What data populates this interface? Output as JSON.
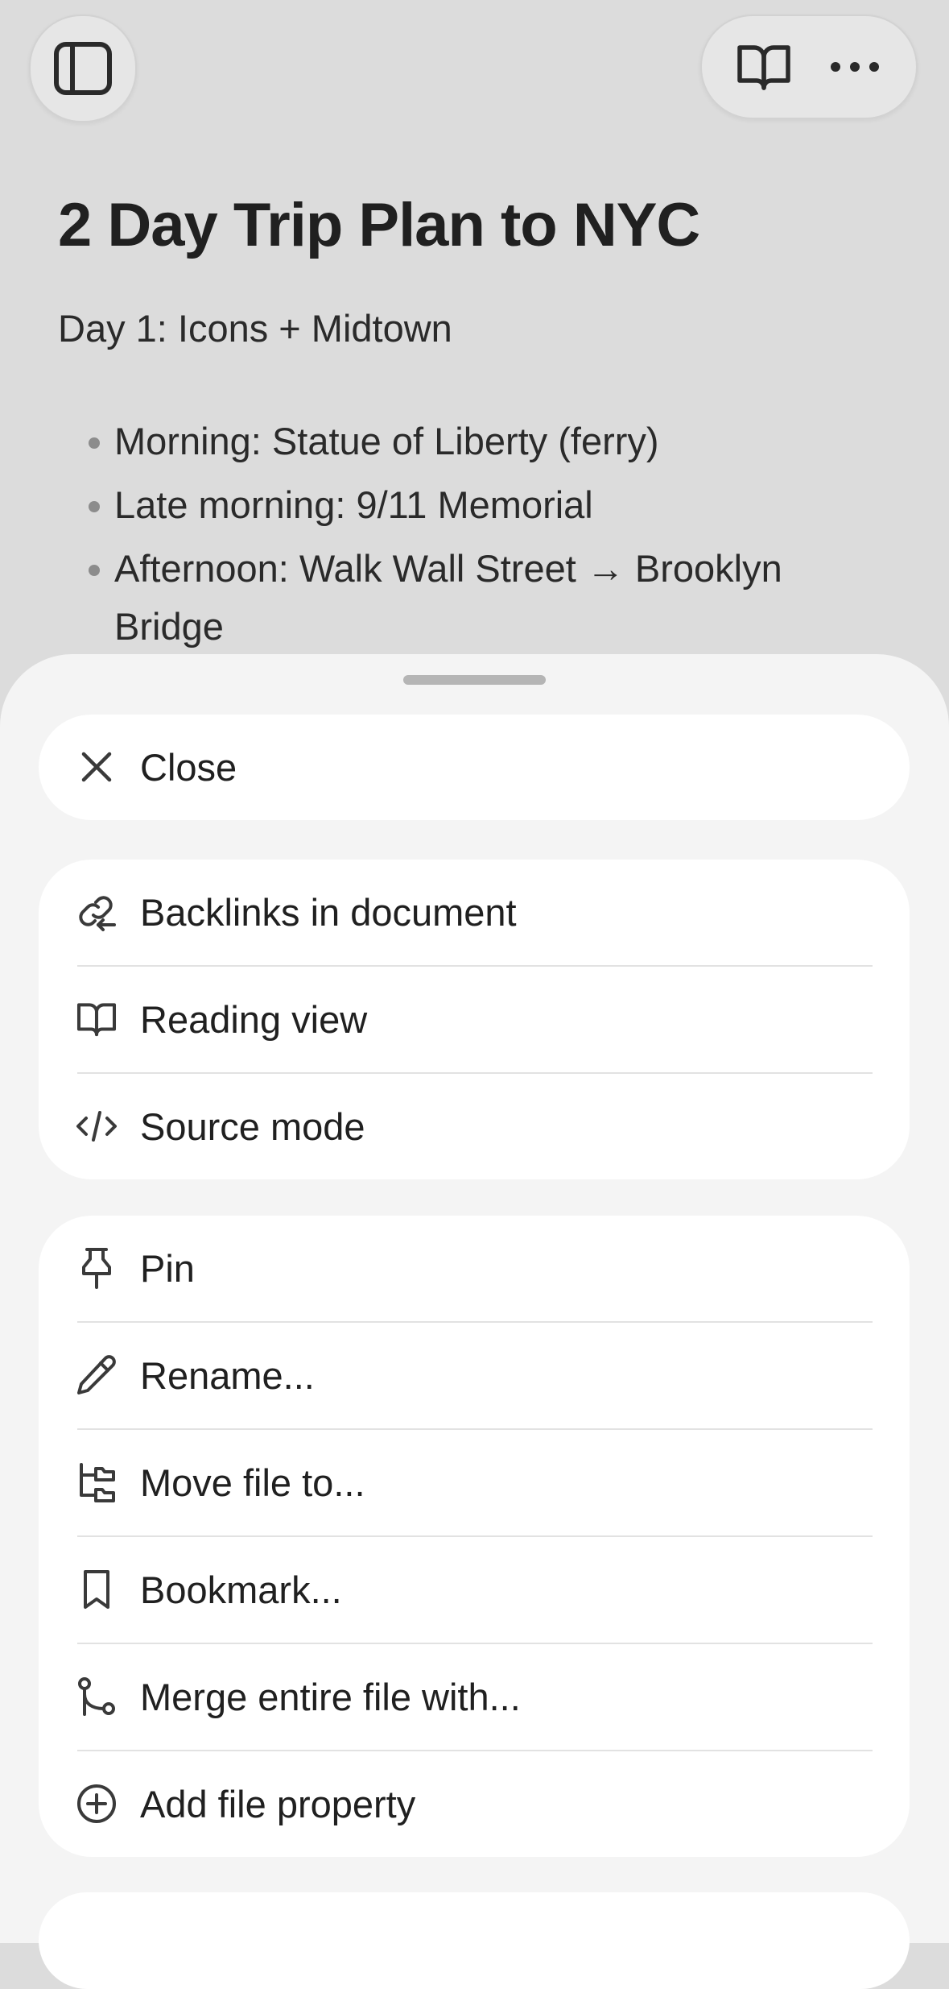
{
  "toolbar": {
    "left_icon": "sidebar-toggle-icon",
    "right_icons": [
      "book-open-icon",
      "more-horizontal-icon"
    ]
  },
  "document": {
    "title": "2 Day Trip Plan to NYC",
    "paragraph": "Day 1: Icons + Midtown",
    "bullets": [
      "Morning: Statue of Liberty (ferry)",
      "Late morning: 9/11 Memorial",
      "Afternoon: Walk Wall Street → Brooklyn Bridge"
    ]
  },
  "sheet": {
    "close": {
      "label": "Close",
      "icon": "close-icon"
    },
    "view_group": [
      {
        "label": "Backlinks in document",
        "icon": "backlink-icon"
      },
      {
        "label": "Reading view",
        "icon": "book-open-icon"
      },
      {
        "label": "Source mode",
        "icon": "code-icon"
      }
    ],
    "file_group": [
      {
        "label": "Pin",
        "icon": "pin-icon"
      },
      {
        "label": "Rename...",
        "icon": "pencil-icon"
      },
      {
        "label": "Move file to...",
        "icon": "folder-tree-icon"
      },
      {
        "label": "Bookmark...",
        "icon": "bookmark-icon"
      },
      {
        "label": "Merge entire file with...",
        "icon": "git-merge-icon"
      },
      {
        "label": "Add file property",
        "icon": "plus-circle-icon"
      }
    ]
  },
  "colors": {
    "background": "#dcdcdc",
    "sheet": "#f4f4f4",
    "group": "#ffffff",
    "text": "#202020"
  }
}
